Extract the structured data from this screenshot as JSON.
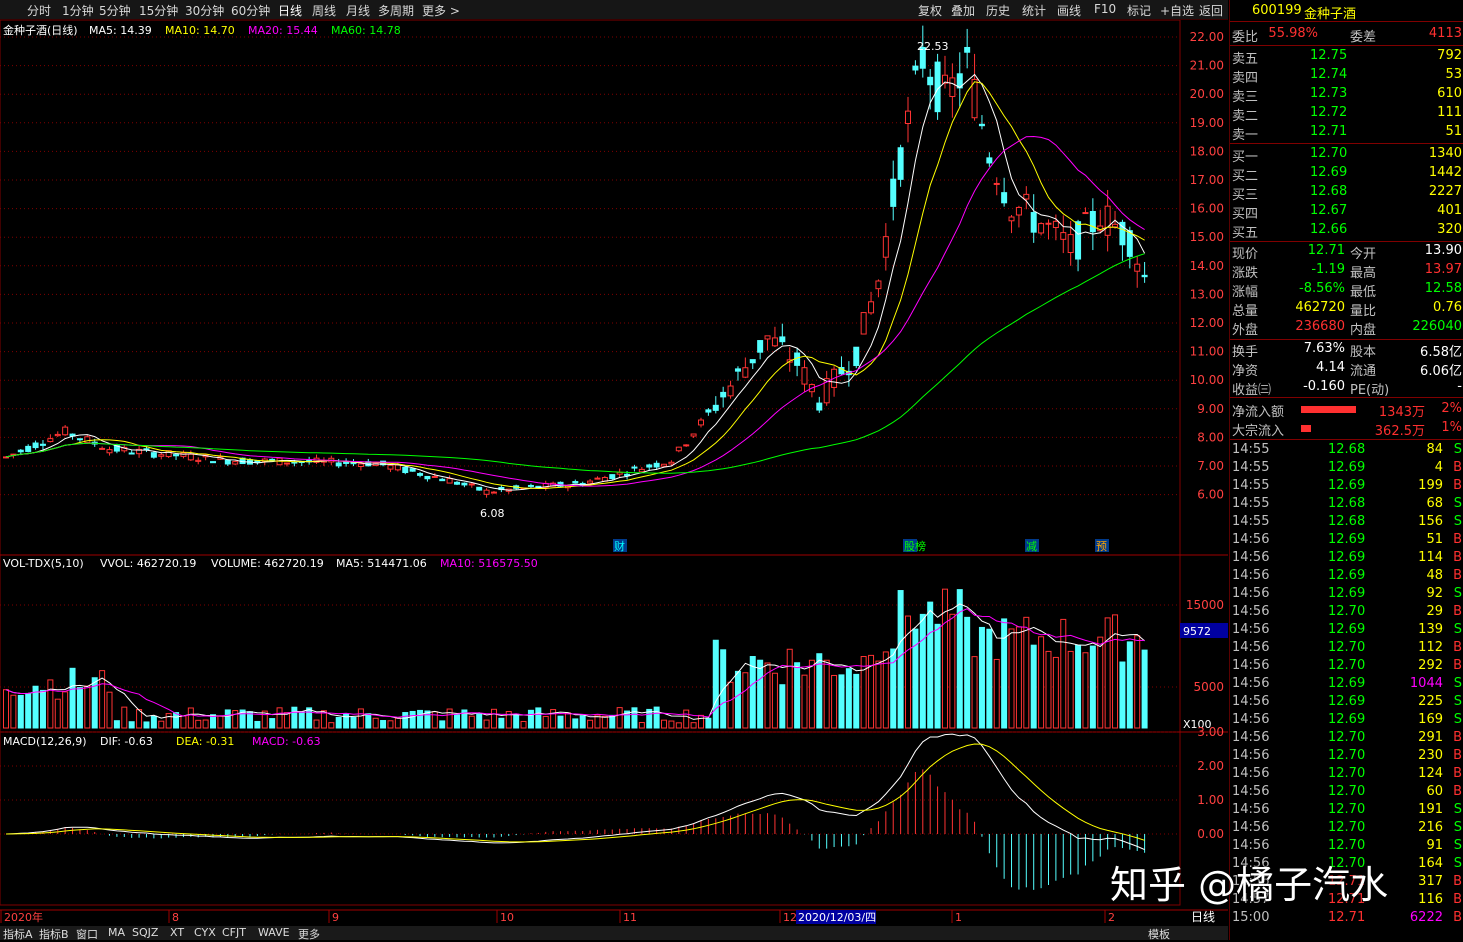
{
  "toolbar": {
    "periods": [
      "分时",
      "1分钟",
      "5分钟",
      "15分钟",
      "30分钟",
      "60分钟",
      "日线",
      "周线",
      "月线",
      "多周期",
      "更多 >"
    ],
    "active": "日线",
    "tools": [
      "复权",
      "叠加",
      "历史",
      "统计",
      "画线",
      "F10",
      "标记",
      "+自选",
      "返回"
    ]
  },
  "legend": {
    "main": [
      {
        "t": "金种子酒(日线)",
        "c": "#ffffff"
      },
      {
        "t": "MA5: 14.39",
        "c": "#ffffff"
      },
      {
        "t": "MA10: 14.70",
        "c": "#ffff00"
      },
      {
        "t": "MA20: 15.44",
        "c": "#ff00ff"
      },
      {
        "t": "MA60: 14.78",
        "c": "#00ff00"
      }
    ],
    "vol": [
      {
        "t": "VOL-TDX(5,10)",
        "c": "#ffffff"
      },
      {
        "t": "VVOL: 462720.19",
        "c": "#ffffff"
      },
      {
        "t": "VOLUME: 462720.19",
        "c": "#ffffff"
      },
      {
        "t": "MA5: 514471.06",
        "c": "#ffffff"
      },
      {
        "t": "MA10: 516575.50",
        "c": "#ff00ff"
      }
    ],
    "macd": [
      {
        "t": "MACD(12,26,9)",
        "c": "#ffffff"
      },
      {
        "t": "DIF: -0.63",
        "c": "#ffffff"
      },
      {
        "t": "DEA: -0.31",
        "c": "#ffff00"
      },
      {
        "t": "MACD: -0.63",
        "c": "#ff00ff"
      }
    ]
  },
  "axes": {
    "price": [
      "22.00",
      "21.00",
      "20.00",
      "19.00",
      "18.00",
      "17.00",
      "16.00",
      "15.00",
      "14.00",
      "13.00",
      "12.00",
      "11.00",
      "10.00",
      "9.00",
      "8.00",
      "7.00",
      "6.00"
    ],
    "vol": [
      "15000",
      "5000"
    ],
    "vol_mark": "9572",
    "vol_unit": "X100",
    "macd": [
      "3.00",
      "2.00",
      "1.00",
      "0.00"
    ]
  },
  "annot": {
    "high": "22.53",
    "low": "6.08",
    "events": [
      "财",
      "股榜",
      "减",
      "预"
    ]
  },
  "dates": [
    "2020年",
    "8",
    "9",
    "10",
    "11",
    "12",
    "1",
    "2"
  ],
  "cursor_date": "2020/12/03/四",
  "period_tag": "日线",
  "bottom": [
    "指标A",
    "指标B",
    "窗口",
    "MA",
    "SQJZ",
    "XT",
    "CYX",
    "CFJT",
    "WAVE",
    "更多",
    "模板"
  ],
  "stock": {
    "code": "600199",
    "name": "金种子酒"
  },
  "weibi": {
    "l1": "委比",
    "v1": "55.98%",
    "l2": "委差",
    "v2": "4113"
  },
  "asks": [
    {
      "l": "卖五",
      "p": "12.75",
      "v": "792"
    },
    {
      "l": "卖四",
      "p": "12.74",
      "v": "53"
    },
    {
      "l": "卖三",
      "p": "12.73",
      "v": "610"
    },
    {
      "l": "卖二",
      "p": "12.72",
      "v": "111"
    },
    {
      "l": "卖一",
      "p": "12.71",
      "v": "51"
    }
  ],
  "bids": [
    {
      "l": "买一",
      "p": "12.70",
      "v": "1340"
    },
    {
      "l": "买二",
      "p": "12.69",
      "v": "1442"
    },
    {
      "l": "买三",
      "p": "12.68",
      "v": "2227"
    },
    {
      "l": "买四",
      "p": "12.67",
      "v": "401"
    },
    {
      "l": "买五",
      "p": "12.66",
      "v": "320"
    }
  ],
  "stats": [
    {
      "l1": "现价",
      "v1": "12.71",
      "c1": "#00ff00",
      "l2": "今开",
      "v2": "13.90",
      "c2": "#ffffff"
    },
    {
      "l1": "涨跌",
      "v1": "-1.19",
      "c1": "#00ff00",
      "l2": "最高",
      "v2": "13.97",
      "c2": "#ff3030"
    },
    {
      "l1": "涨幅",
      "v1": "-8.56%",
      "c1": "#00ff00",
      "l2": "最低",
      "v2": "12.58",
      "c2": "#00ff00"
    },
    {
      "l1": "总量",
      "v1": "462720",
      "c1": "#ffff00",
      "l2": "量比",
      "v2": "0.76",
      "c2": "#ffff00"
    },
    {
      "l1": "外盘",
      "v1": "236680",
      "c1": "#ff3030",
      "l2": "内盘",
      "v2": "226040",
      "c2": "#00ff00"
    },
    {
      "l1": "换手",
      "v1": "7.63%",
      "c1": "#ffffff",
      "l2": "股本",
      "v2": "6.58亿",
      "c2": "#ffffff"
    },
    {
      "l1": "净资",
      "v1": "4.14",
      "c1": "#ffffff",
      "l2": "流通",
      "v2": "6.06亿",
      "c2": "#ffffff"
    },
    {
      "l1": "收益㈢",
      "v1": "-0.160",
      "c1": "#ffffff",
      "l2": "PE(动)",
      "v2": "-",
      "c2": "#ffffff"
    }
  ],
  "flow": [
    {
      "l": "净流入额",
      "v": "1343万",
      "pct": "2%",
      "bar": 0.55
    },
    {
      "l": "大宗流入",
      "v": "362.5万",
      "pct": "1%",
      "bar": 0.1
    }
  ],
  "ticks": [
    [
      "14:55",
      "12.68",
      "84",
      "S"
    ],
    [
      "14:55",
      "12.69",
      "4",
      "B"
    ],
    [
      "14:55",
      "12.69",
      "199",
      "B"
    ],
    [
      "14:55",
      "12.68",
      "68",
      "S"
    ],
    [
      "14:55",
      "12.68",
      "156",
      "S"
    ],
    [
      "14:56",
      "12.69",
      "51",
      "B"
    ],
    [
      "14:56",
      "12.69",
      "114",
      "B"
    ],
    [
      "14:56",
      "12.69",
      "48",
      "B"
    ],
    [
      "14:56",
      "12.69",
      "92",
      "S"
    ],
    [
      "14:56",
      "12.70",
      "29",
      "B"
    ],
    [
      "14:56",
      "12.69",
      "139",
      "S"
    ],
    [
      "14:56",
      "12.70",
      "112",
      "B"
    ],
    [
      "14:56",
      "12.70",
      "292",
      "B"
    ],
    [
      "14:56",
      "12.69",
      "1044",
      "S"
    ],
    [
      "14:56",
      "12.69",
      "225",
      "S"
    ],
    [
      "14:56",
      "12.69",
      "169",
      "S"
    ],
    [
      "14:56",
      "12.70",
      "291",
      "B"
    ],
    [
      "14:56",
      "12.70",
      "230",
      "B"
    ],
    [
      "14:56",
      "12.70",
      "124",
      "B"
    ],
    [
      "14:56",
      "12.70",
      "60",
      "B"
    ],
    [
      "14:56",
      "12.70",
      "191",
      "S"
    ],
    [
      "14:56",
      "12.70",
      "216",
      "S"
    ],
    [
      "14:56",
      "12.70",
      "91",
      "S"
    ],
    [
      "14:56",
      "12.70",
      "164",
      "S"
    ],
    [
      "14:56",
      "12.71",
      "317",
      "B"
    ],
    [
      "14:57",
      "12.71",
      "116",
      "B"
    ],
    [
      "15:00",
      "12.71",
      "6222",
      "B"
    ]
  ],
  "watermark": "知乎 @橘子汽水",
  "colors": {
    "up": "#ff3333",
    "down": "#54ffff",
    "ma5": "#ffffff",
    "ma10": "#ffff00",
    "ma20": "#ff00ff",
    "ma60": "#00ff00",
    "grid": "#800000"
  }
}
